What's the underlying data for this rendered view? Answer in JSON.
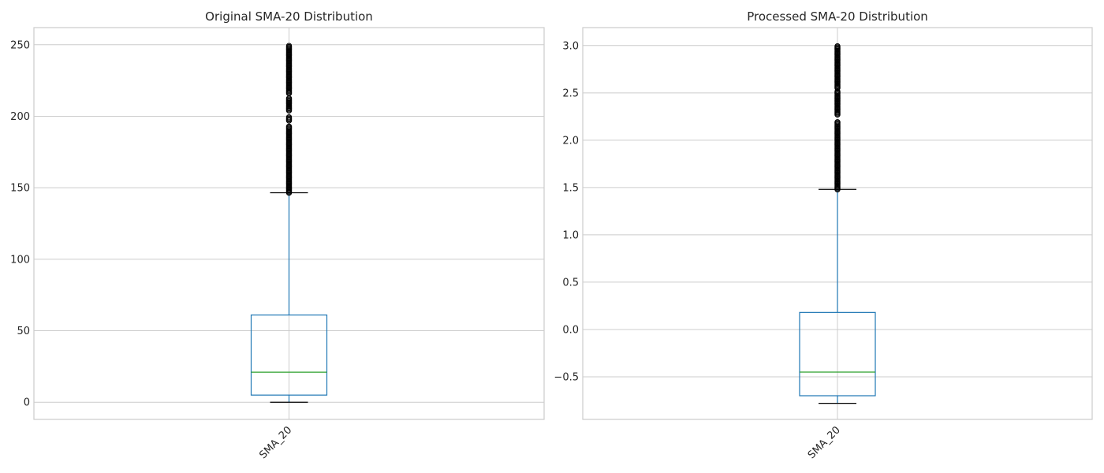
{
  "chart_data": [
    {
      "type": "box",
      "title": "Original SMA-20 Distribution",
      "categories": [
        "SMA_20"
      ],
      "ylim": [
        -12,
        262
      ],
      "yticks": [
        0,
        50,
        100,
        150,
        200,
        250
      ],
      "ytick_labels": [
        "0",
        "50",
        "100",
        "150",
        "200",
        "250"
      ],
      "grid": true,
      "box": {
        "whisker_low": 0,
        "q1": 5,
        "median": 21,
        "q3": 61,
        "whisker_high": 146.5
      },
      "outlier_segments": [
        [
          146.5,
          193
        ],
        [
          197,
          200
        ],
        [
          204,
          213
        ],
        [
          216,
          249.5
        ]
      ],
      "colors": {
        "box": "#1f77b4",
        "median": "#2ca02c",
        "whisker": "#1f77b4",
        "cap": "#000000",
        "flier": "#000000",
        "grid": "#cccccc",
        "frame": "#cccccc"
      }
    },
    {
      "type": "box",
      "title": "Processed SMA-20 Distribution",
      "categories": [
        "SMA_20"
      ],
      "ylim": [
        -0.95,
        3.19
      ],
      "yticks": [
        -0.5,
        0.0,
        0.5,
        1.0,
        1.5,
        2.0,
        2.5,
        3.0
      ],
      "ytick_labels": [
        "−0.5",
        "0.0",
        "0.5",
        "1.0",
        "1.5",
        "2.0",
        "2.5",
        "3.0"
      ],
      "grid": true,
      "box": {
        "whisker_low": -0.78,
        "q1": -0.7,
        "median": -0.45,
        "q3": 0.18,
        "whisker_high": 1.48
      },
      "outlier_segments": [
        [
          1.48,
          2.2
        ],
        [
          2.27,
          2.52
        ],
        [
          2.55,
          3.0
        ]
      ],
      "colors": {
        "box": "#1f77b4",
        "median": "#2ca02c",
        "whisker": "#1f77b4",
        "cap": "#000000",
        "flier": "#000000",
        "grid": "#cccccc",
        "frame": "#cccccc"
      }
    }
  ]
}
